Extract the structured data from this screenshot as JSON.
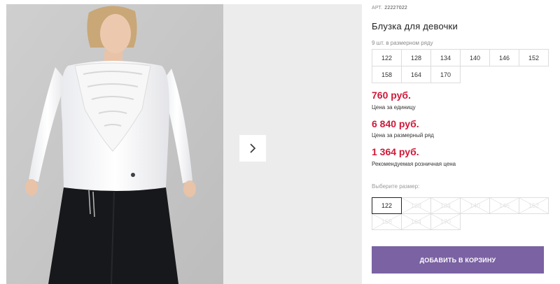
{
  "product": {
    "article_label": "АРТ.",
    "article_number": "22227022",
    "title": "Блузка для девочки",
    "pack_note": "9 шт. в размерном ряду",
    "pack_sizes": [
      "122",
      "128",
      "134",
      "140",
      "146",
      "152",
      "158",
      "164",
      "170"
    ]
  },
  "pricing": {
    "unit_price": "760 руб.",
    "unit_label": "Цена за единицу",
    "pack_price": "6 840 руб.",
    "pack_label": "Цена за размерный ряд",
    "retail_price": "1 364 руб.",
    "retail_label": "Рекомендуемая розничная цена"
  },
  "size_selector": {
    "label": "Выберите размер:",
    "selected": "122",
    "options": [
      "122",
      "128",
      "134",
      "140",
      "146",
      "152",
      "158",
      "164",
      "170"
    ]
  },
  "cart": {
    "add_button": "ДОБАВИТЬ В КОРЗИНУ"
  },
  "gallery": {
    "next_icon": "chevron-right-icon",
    "photo": "girl in white lace blouse and dark trousers"
  },
  "colors": {
    "price": "#d0193a",
    "button": "#7b62a3",
    "photo_background": "#d2d2d2",
    "side_panel": "#ececec"
  }
}
